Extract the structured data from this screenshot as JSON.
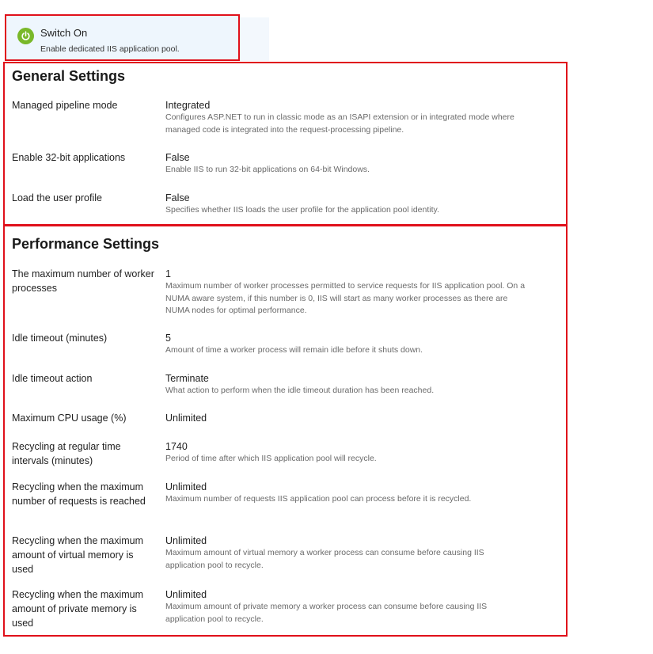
{
  "switch": {
    "title": "Switch On",
    "description": "Enable dedicated IIS application pool.",
    "icon": "power-icon",
    "icon_color": "#79b829"
  },
  "general": {
    "title": "General Settings",
    "rows": [
      {
        "label": "Managed pipeline mode",
        "value": "Integrated",
        "desc": "Configures ASP.NET to run in classic mode as an ISAPI extension or in integrated mode where managed code is integrated into the request-processing pipeline."
      },
      {
        "label": "Enable 32-bit applications",
        "value": "False",
        "desc": "Enable IIS to run 32-bit applications on 64-bit Windows."
      },
      {
        "label": "Load the user profile",
        "value": "False",
        "desc": "Specifies whether IIS loads the user profile for the application pool identity."
      }
    ]
  },
  "performance": {
    "title": "Performance Settings",
    "rows": [
      {
        "label": "The maximum number of worker processes",
        "value": "1",
        "desc": "Maximum number of worker processes permitted to service requests for IIS application pool. On a NUMA aware system, if this number is 0, IIS will start as many worker processes as there are NUMA nodes for optimal performance."
      },
      {
        "label": "Idle timeout (minutes)",
        "value": "5",
        "desc": "Amount of time a worker process will remain idle before it shuts down."
      },
      {
        "label": "Idle timeout action",
        "value": "Terminate",
        "desc": "What action to perform when the idle timeout duration has been reached."
      },
      {
        "label": "Maximum CPU usage (%)",
        "value": "Unlimited",
        "desc": ""
      },
      {
        "label": "Recycling at regular time intervals (minutes)",
        "value": "1740",
        "desc": "Period of time after which IIS application pool will recycle."
      },
      {
        "label": "Recycling when the maximum number of requests is reached",
        "value": "Unlimited",
        "desc": "Maximum number of requests IIS application pool can process before it is recycled."
      },
      {
        "label": "Recycling when the maximum amount of virtual memory is used",
        "value": "Unlimited",
        "desc": "Maximum amount of virtual memory a worker process can consume before causing IIS application pool to recycle."
      },
      {
        "label": "Recycling when the maximum amount of private memory is used",
        "value": "Unlimited",
        "desc": "Maximum amount of private memory a worker process can consume before causing IIS application pool to recycle."
      }
    ]
  },
  "colors": {
    "highlight_border": "#e0101a",
    "switch_bg": "#eef6fd",
    "desc_text": "#6a6a6a"
  }
}
